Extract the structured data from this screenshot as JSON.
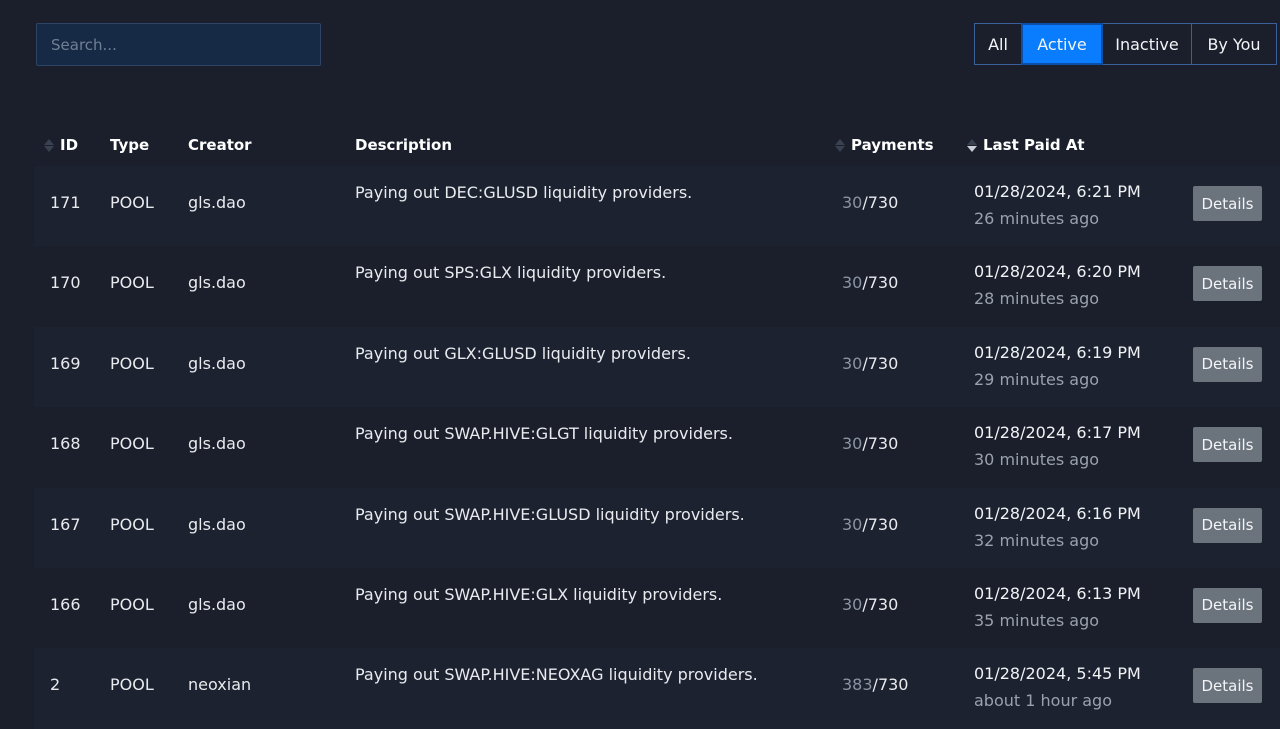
{
  "search": {
    "placeholder": "Search..."
  },
  "filters": [
    {
      "label": "All"
    },
    {
      "label": "Active"
    },
    {
      "label": "Inactive"
    },
    {
      "label": "By You"
    }
  ],
  "table": {
    "headers": {
      "id": "ID",
      "type": "Type",
      "creator": "Creator",
      "description": "Description",
      "payments": "Payments",
      "last_paid": "Last Paid At"
    },
    "details_label": "Details",
    "rows": [
      {
        "id": "171",
        "type": "POOL",
        "creator": "gls.dao",
        "description": "Paying out DEC:GLUSD liquidity providers.",
        "paid": "30",
        "total": "/730",
        "date": "01/28/2024, 6:21 PM",
        "ago": "26 minutes ago"
      },
      {
        "id": "170",
        "type": "POOL",
        "creator": "gls.dao",
        "description": "Paying out SPS:GLX liquidity providers.",
        "paid": "30",
        "total": "/730",
        "date": "01/28/2024, 6:20 PM",
        "ago": "28 minutes ago"
      },
      {
        "id": "169",
        "type": "POOL",
        "creator": "gls.dao",
        "description": "Paying out GLX:GLUSD liquidity providers.",
        "paid": "30",
        "total": "/730",
        "date": "01/28/2024, 6:19 PM",
        "ago": "29 minutes ago"
      },
      {
        "id": "168",
        "type": "POOL",
        "creator": "gls.dao",
        "description": "Paying out SWAP.HIVE:GLGT liquidity providers.",
        "paid": "30",
        "total": "/730",
        "date": "01/28/2024, 6:17 PM",
        "ago": "30 minutes ago"
      },
      {
        "id": "167",
        "type": "POOL",
        "creator": "gls.dao",
        "description": "Paying out SWAP.HIVE:GLUSD liquidity providers.",
        "paid": "30",
        "total": "/730",
        "date": "01/28/2024, 6:16 PM",
        "ago": "32 minutes ago"
      },
      {
        "id": "166",
        "type": "POOL",
        "creator": "gls.dao",
        "description": "Paying out SWAP.HIVE:GLX liquidity providers.",
        "paid": "30",
        "total": "/730",
        "date": "01/28/2024, 6:13 PM",
        "ago": "35 minutes ago"
      },
      {
        "id": "2",
        "type": "POOL",
        "creator": "neoxian",
        "description": "Paying out SWAP.HIVE:NEOXAG liquidity providers.",
        "paid": "383",
        "total": "/730",
        "date": "01/28/2024, 5:45 PM",
        "ago": "about 1 hour ago"
      }
    ]
  }
}
